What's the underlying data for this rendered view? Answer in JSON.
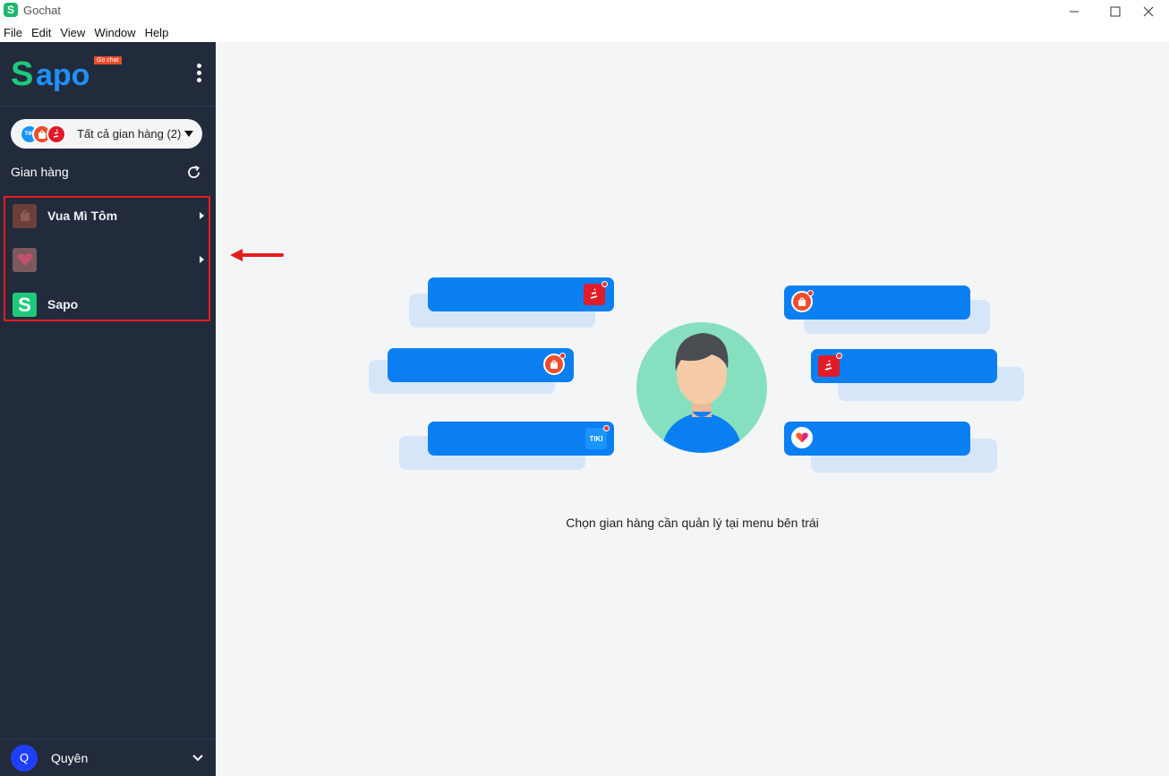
{
  "window": {
    "title": "Gochat",
    "app_icon": "S"
  },
  "menu": [
    "File",
    "Edit",
    "View",
    "Window",
    "Help"
  ],
  "sidebar": {
    "logo_s": "S",
    "logo_rest": "apo",
    "logo_badge": "Go chat",
    "store_selector": {
      "label": "Tất cả gian hàng (2)",
      "tiki_mark": "TIKI"
    },
    "section_title": "Gian hàng",
    "stores": [
      {
        "name": "Vua Mì Tôm",
        "platform": "shopee",
        "has_arrow": true
      },
      {
        "name": "",
        "platform": "lazada",
        "has_arrow": true
      },
      {
        "name": "Sapo",
        "platform": "sapo",
        "has_arrow": false
      }
    ],
    "sapo_mark": "S",
    "user": {
      "initial": "Q",
      "name": "Quyên"
    }
  },
  "main": {
    "caption": "Chọn gian hàng cần quản lý tại menu bên trái",
    "tiki_mark": "TIKI"
  },
  "colors": {
    "sidebar_bg": "#222b3c",
    "main_bg": "#f4f5f7",
    "bubble": "#0a7ff1",
    "highlight_border": "#e51d1d",
    "sapo_green": "#1ec97b"
  },
  "icons": [
    "kebab-menu-icon",
    "refresh-icon",
    "caret-down-icon",
    "chevron-down-icon",
    "red-arrow-icon",
    "shopee-icon",
    "sendo-icon",
    "tiki-icon",
    "lazada-icon",
    "person-avatar-icon"
  ]
}
